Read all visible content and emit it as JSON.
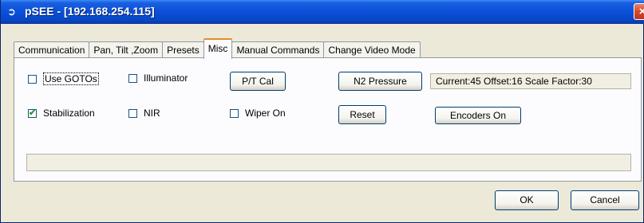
{
  "window": {
    "title": "pSEE - [192.168.254.115]",
    "close_glyph": "×"
  },
  "tabs": [
    {
      "label": "Communication",
      "active": false
    },
    {
      "label": "Pan, Tilt ,Zoom",
      "active": false
    },
    {
      "label": "Presets",
      "active": false
    },
    {
      "label": "Misc",
      "active": true
    },
    {
      "label": "Manual Commands",
      "active": false
    },
    {
      "label": "Change Video Mode",
      "active": false
    }
  ],
  "misc": {
    "use_gotos": {
      "label": "Use GOTOs",
      "checked": false
    },
    "illuminator": {
      "label": "Illuminator",
      "checked": false
    },
    "stabilization": {
      "label": "Stabilization",
      "checked": true
    },
    "nir": {
      "label": "NIR",
      "checked": false
    },
    "wiper_on": {
      "label": "Wiper On",
      "checked": false
    },
    "pt_cal_label": "P/T Cal",
    "n2_pressure_label": "N2 Pressure",
    "reset_label": "Reset",
    "encoders_on_label": "Encoders On",
    "readout": "Current:45  Offset:16  Scale Factor:30"
  },
  "footer": {
    "ok_label": "OK",
    "cancel_label": "Cancel"
  },
  "colors": {
    "title_bar": "#0a50d8",
    "check": "#21a121",
    "active_tab_accent": "#e68b2c"
  }
}
